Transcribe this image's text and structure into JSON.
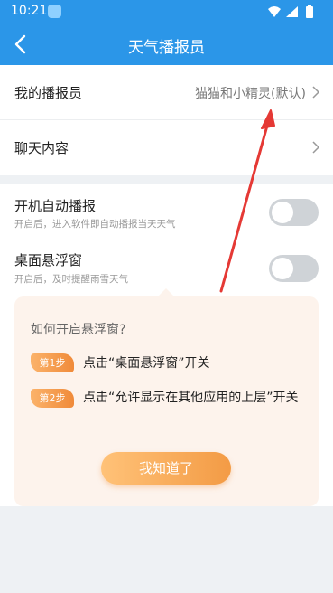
{
  "status_bar": {
    "time": "10:21"
  },
  "header": {
    "title": "天气播报员"
  },
  "settings": {
    "my_announcer": {
      "label": "我的播报员",
      "value": "猫猫和小精灵(默认)"
    },
    "chat_content": {
      "label": "聊天内容"
    },
    "auto_broadcast": {
      "label": "开机自动播报",
      "desc": "开启后，进入软件即自动播报当天天气"
    },
    "floating_window": {
      "label": "桌面悬浮窗",
      "desc": "开启后，及时提醒雨雪天气"
    }
  },
  "popup": {
    "title": "如何开启悬浮窗?",
    "steps": [
      {
        "badge": "第1步",
        "text": "点击“桌面悬浮窗”开关"
      },
      {
        "badge": "第2步",
        "text": "点击“允许显示在其他应用的上层”开关"
      }
    ],
    "ok_label": "我知道了"
  },
  "colors": {
    "brand": "#2b96e8",
    "accent": "#f39b45",
    "annotation": "#e53935"
  },
  "icons": [
    "back-arrow-icon",
    "chevron-right-icon",
    "wifi-icon",
    "signal-icon",
    "battery-icon"
  ]
}
